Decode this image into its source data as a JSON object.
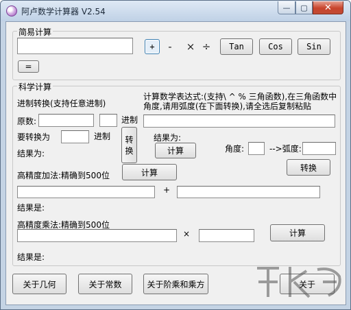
{
  "window": {
    "title": "阿卢数学计算器 V2.54",
    "min_glyph": "—",
    "max_glyph": "▢",
    "close_glyph": "✕"
  },
  "simple": {
    "group_title": "简易计算",
    "plus": "+",
    "minus": "-",
    "times": "×",
    "divide": "÷",
    "tan": "Tan",
    "cos": "Cos",
    "sin": "Sin",
    "equals": "="
  },
  "science": {
    "group_title": "科学计算",
    "base_title": "进制转换(支持任意进制)",
    "original_label": "原数:",
    "base_suffix": "进制",
    "target_label": "要转换为",
    "target_suffix": "进制",
    "result_label": "结果为:",
    "convert_chars": [
      "转",
      "换"
    ],
    "expr_desc": "计算数学表达式:(支持\\ ^ % 三角函数),在三角函数中角度,请用弧度(在下面转换),请全选后复制粘贴",
    "expr_result_label": "结果为:",
    "expr_calc": "计算",
    "angle_label": "角度:",
    "radian_label": "-->弧度:",
    "angle_convert": "转换",
    "hp_add_title": "高精度加法:精确到500位",
    "hp_add_calc": "计算",
    "plus_sign": "+",
    "add_result_label": "结果是:",
    "hp_mul_title": "高精度乘法:精确到500位",
    "times_sign": "×",
    "mul_calc": "计算",
    "mul_result_label": "结果是:"
  },
  "footer": {
    "about_geometry": "关于几何",
    "about_constants": "关于常数",
    "about_factorial": "关于阶乘和乘方",
    "about": "关于"
  }
}
